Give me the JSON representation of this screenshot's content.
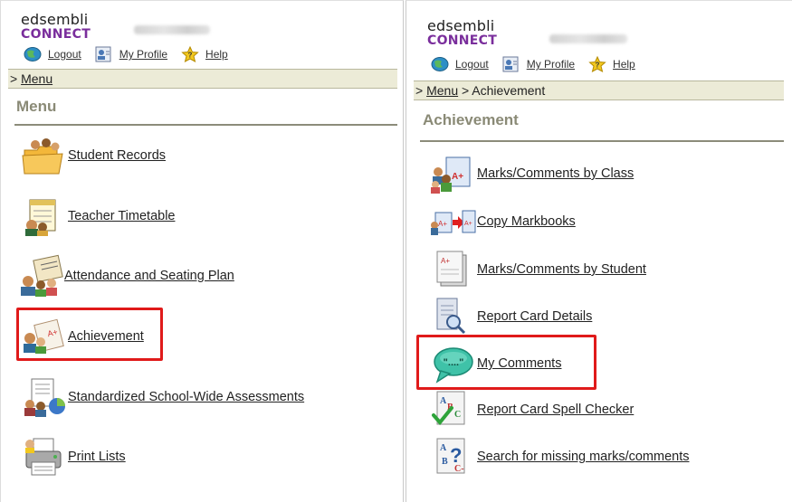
{
  "left": {
    "logo": {
      "line1": "edsembli",
      "line2": "CONNECT"
    },
    "user_links": {
      "logout": "Logout",
      "profile": "My Profile",
      "help": "Help"
    },
    "breadcrumb": {
      "prefix": ">",
      "menu": "Menu",
      "current": ""
    },
    "title": "Menu",
    "items": [
      {
        "label": "Student Records",
        "icon": "folder-students-icon"
      },
      {
        "label": "Teacher Timetable",
        "icon": "timetable-icon"
      },
      {
        "label": "Attendance and Seating Plan",
        "icon": "attendance-icon"
      },
      {
        "label": "Achievement",
        "icon": "achievement-icon"
      },
      {
        "label": "Standardized School-Wide Assessments",
        "icon": "assessment-chart-icon"
      },
      {
        "label": "Print Lists",
        "icon": "printer-icon"
      }
    ]
  },
  "right": {
    "logo": {
      "line1": "edsembli",
      "line2": "CONNECT"
    },
    "user_links": {
      "logout": "Logout",
      "profile": "My Profile",
      "help": "Help"
    },
    "breadcrumb": {
      "prefix": ">",
      "menu": "Menu",
      "current": "> Achievement"
    },
    "title": "Achievement",
    "items": [
      {
        "label": "Marks/Comments by Class",
        "icon": "class-marks-icon"
      },
      {
        "label": "Copy Markbooks",
        "icon": "copy-markbook-icon"
      },
      {
        "label": "Marks/Comments by Student",
        "icon": "student-marks-icon"
      },
      {
        "label": "Report Card Details",
        "icon": "report-card-search-icon"
      },
      {
        "label": "My Comments",
        "icon": "speech-bubble-icon"
      },
      {
        "label": "Report Card Spell Checker",
        "icon": "spell-check-icon"
      },
      {
        "label": "Search for missing marks/comments",
        "icon": "missing-marks-search-icon"
      }
    ]
  },
  "colors": {
    "highlight": "#e01a1a",
    "brand_purple": "#7a2e9c",
    "crumb_bg": "#ecebd7",
    "title": "#8a8a76"
  }
}
